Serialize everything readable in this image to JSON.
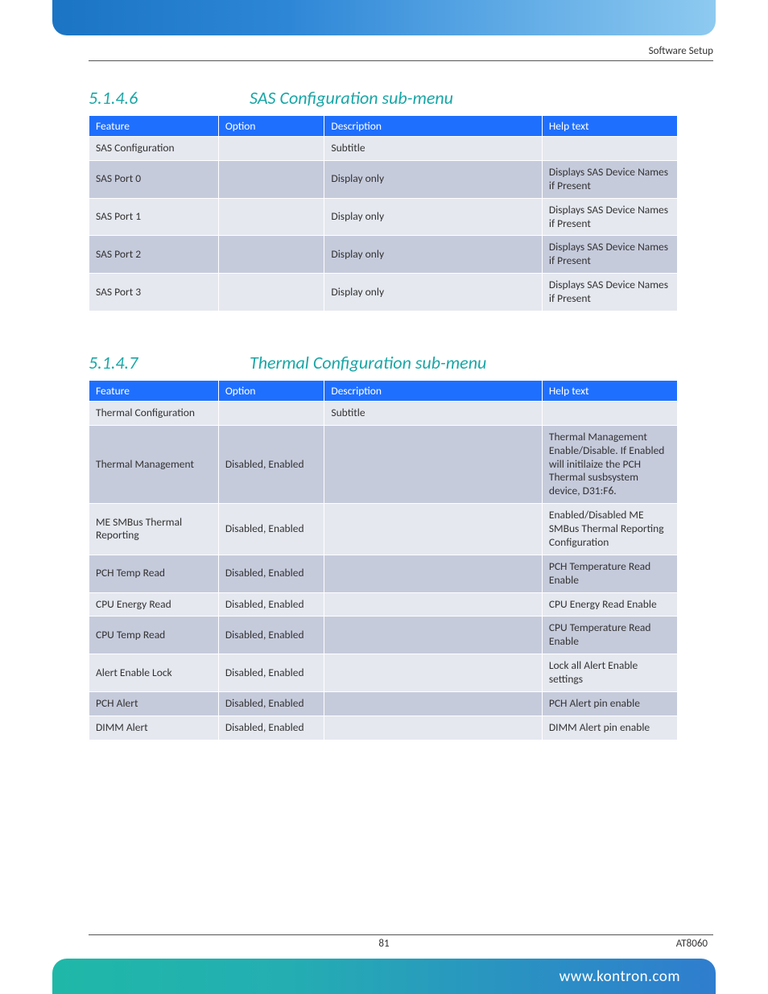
{
  "header": {
    "breadcrumb": "Software Setup"
  },
  "section1": {
    "number": "5.1.4.6",
    "title": "SAS Configuration sub-menu",
    "columns": [
      "Feature",
      "Option",
      "Description",
      "Help text"
    ],
    "rows": [
      {
        "feature": "SAS Configuration",
        "option": "",
        "description": "Subtitle",
        "help": "",
        "alt": false
      },
      {
        "feature": "SAS Port 0",
        "option": "",
        "description": "Display only",
        "help": "Displays SAS Device Names if Present",
        "alt": true
      },
      {
        "feature": "SAS Port 1",
        "option": "",
        "description": "Display only",
        "help": "Displays SAS Device Names if Present",
        "alt": false
      },
      {
        "feature": "SAS Port 2",
        "option": "",
        "description": "Display only",
        "help": "Displays SAS Device Names if Present",
        "alt": true
      },
      {
        "feature": "SAS Port 3",
        "option": "",
        "description": "Display only",
        "help": "Displays SAS Device Names if Present",
        "alt": false
      }
    ]
  },
  "section2": {
    "number": "5.1.4.7",
    "title": "Thermal Configuration sub-menu",
    "columns": [
      "Feature",
      "Option",
      "Description",
      "Help text"
    ],
    "rows": [
      {
        "feature": "Thermal Configuration",
        "option": "",
        "description": "Subtitle",
        "help": "",
        "alt": false
      },
      {
        "feature": "Thermal Management",
        "option": "Disabled, Enabled",
        "description": "",
        "help": "Thermal Management Enable/Disable. If Enabled will initilaize the PCH Thermal susbsystem device, D31:F6.",
        "alt": true
      },
      {
        "feature": "ME SMBus Thermal Reporting",
        "option": "Disabled, Enabled",
        "description": "",
        "help": "Enabled/Disabled ME SMBus Thermal Reporting Configuration",
        "alt": false
      },
      {
        "feature": "PCH Temp Read",
        "option": "Disabled, Enabled",
        "description": "",
        "help": "PCH Temperature Read Enable",
        "alt": true
      },
      {
        "feature": "CPU Energy Read",
        "option": "Disabled, Enabled",
        "description": "",
        "help": "CPU Energy Read Enable",
        "alt": false
      },
      {
        "feature": "CPU Temp Read",
        "option": "Disabled, Enabled",
        "description": "",
        "help": "CPU Temperature Read Enable",
        "alt": true
      },
      {
        "feature": "Alert Enable Lock",
        "option": "Disabled, Enabled",
        "description": "",
        "help": "Lock all Alert Enable settings",
        "alt": false
      },
      {
        "feature": "PCH Alert",
        "option": "Disabled, Enabled",
        "description": "",
        "help": "PCH Alert pin enable",
        "alt": true
      },
      {
        "feature": "DIMM Alert",
        "option": "Disabled, Enabled",
        "description": "",
        "help": "DIMM Alert pin enable",
        "alt": false
      }
    ]
  },
  "footer": {
    "page": "81",
    "model": "AT8060",
    "url": "www.kontron.com"
  }
}
